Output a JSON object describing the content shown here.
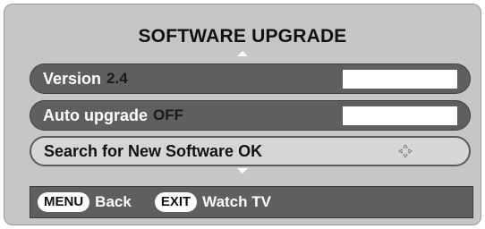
{
  "title": "SOFTWARE UPGRADE",
  "menu": {
    "version": {
      "label": "Version",
      "value": "2.4"
    },
    "auto_upgrade": {
      "label": "Auto upgrade",
      "value": "OFF"
    },
    "search": {
      "label": "Search for New Software OK"
    }
  },
  "footer": {
    "menu_key": "MENU",
    "menu_label": "Back",
    "exit_key": "EXIT",
    "exit_label": "Watch TV"
  },
  "colors": {
    "panel": "#c6c6c6",
    "row_dark": "#5f5f5f",
    "row_selected": "#d6d6d6"
  },
  "icons": [
    "up-arrow-icon",
    "down-arrow-icon",
    "navigation-cross-icon"
  ]
}
